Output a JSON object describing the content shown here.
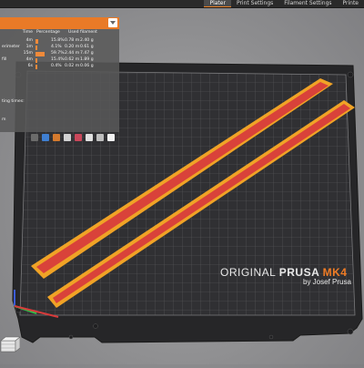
{
  "tabs": [
    {
      "label": "Plater",
      "active": true
    },
    {
      "label": "Print Settings",
      "active": false
    },
    {
      "label": "Filament Settings",
      "active": false
    },
    {
      "label": "Printe",
      "active": false
    }
  ],
  "legend": {
    "columns": [
      "Time",
      "Percentage",
      "Used filament"
    ],
    "rows": [
      {
        "name": "",
        "time": "4m",
        "percent": 15.8,
        "pct_label": "15.8%",
        "length": "0.78 m",
        "weight": "2.40 g"
      },
      {
        "name": "erimeter",
        "time": "1m",
        "percent": 4.1,
        "pct_label": "4.1%",
        "length": "0.20 m",
        "weight": "0.61 g"
      },
      {
        "name": "",
        "time": "15m",
        "percent": 59.7,
        "pct_label": "59.7%",
        "length": "2.44 m",
        "weight": "7.47 g"
      },
      {
        "name": "fill",
        "time": "4m",
        "percent": 15.4,
        "pct_label": "15.4%",
        "length": "0.62 m",
        "weight": "1.89 g"
      },
      {
        "name": "",
        "time": "6s",
        "percent": 0.4,
        "pct_label": "0.4%",
        "length": "0.02 m",
        "weight": "0.06 g"
      }
    ],
    "note_times": "ting times:",
    "note_m": "m"
  },
  "watermark": {
    "original": "ORIGINAL ",
    "prusa": "PRUSA ",
    "model": "MK4",
    "byline": "by Josef Prusa"
  },
  "colors": {
    "accent": "#e97a27",
    "bed": "#2d2d2f",
    "grid": "#5a5a5c",
    "part_fill": "#d9423a",
    "part_edge": "#f0a326"
  },
  "icons": [
    "cube-icon",
    "toolbar-icons"
  ]
}
